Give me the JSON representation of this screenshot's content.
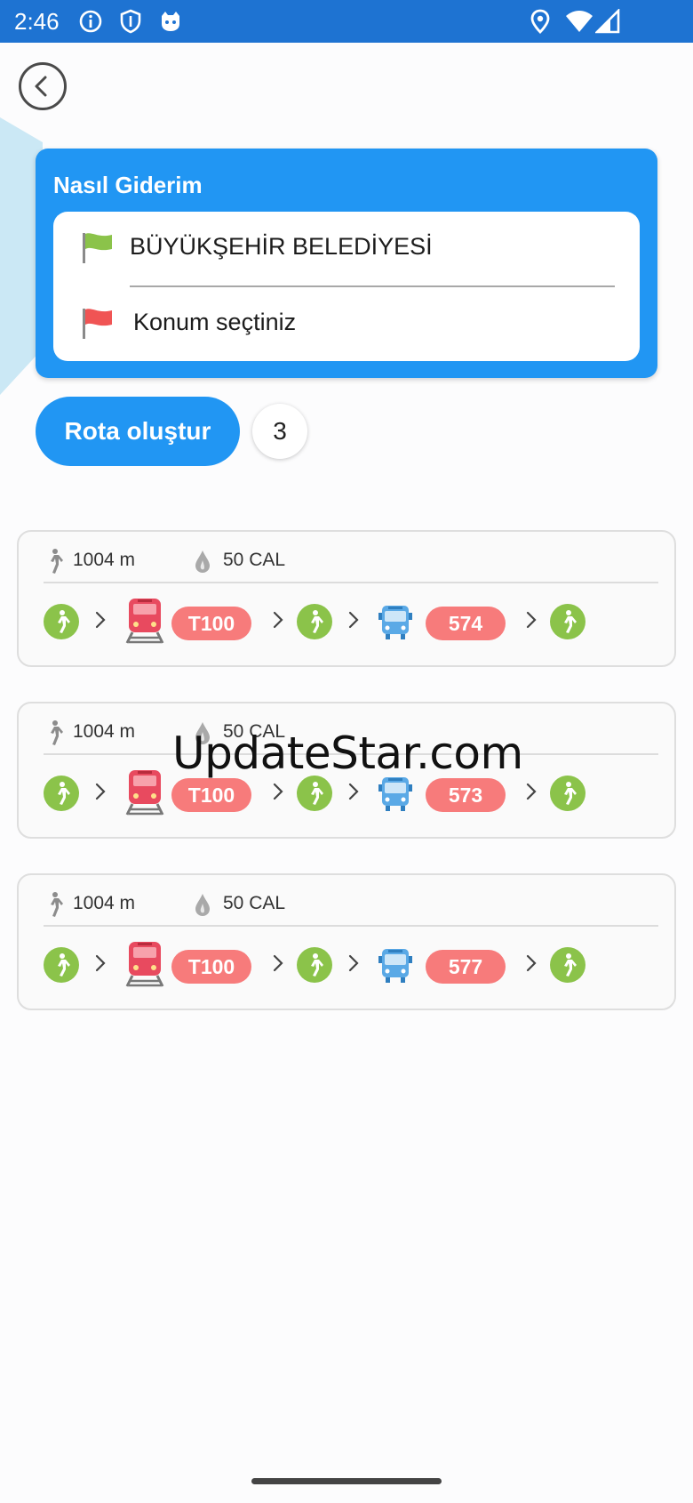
{
  "status_bar": {
    "time": "2:46",
    "left_icons": [
      "info-icon",
      "shield-icon",
      "cat-icon"
    ],
    "right_icons": [
      "location-icon",
      "wifi-icon",
      "signal-icon"
    ]
  },
  "header": {
    "back_icon": "chevron-left-icon"
  },
  "planner": {
    "title": "Nasıl Giderim",
    "from_label": "BÜYÜKŞEHİR BELEDİYESİ",
    "from_flag_color": "#8bc34a",
    "to_label": "Konum seçtiniz",
    "to_flag_color": "#f05454"
  },
  "route_button": {
    "label": "Rota oluştur"
  },
  "route_count": "3",
  "routes": [
    {
      "distance": "1004 m",
      "calories": "50 CAL",
      "steps": [
        {
          "type": "walk"
        },
        {
          "type": "train",
          "line": "T100"
        },
        {
          "type": "walk"
        },
        {
          "type": "bus",
          "line": "574"
        },
        {
          "type": "walk"
        }
      ]
    },
    {
      "distance": "1004 m",
      "calories": "50 CAL",
      "steps": [
        {
          "type": "walk"
        },
        {
          "type": "train",
          "line": "T100"
        },
        {
          "type": "walk"
        },
        {
          "type": "bus",
          "line": "573"
        },
        {
          "type": "walk"
        }
      ]
    },
    {
      "distance": "1004 m",
      "calories": "50 CAL",
      "steps": [
        {
          "type": "walk"
        },
        {
          "type": "train",
          "line": "T100"
        },
        {
          "type": "walk"
        },
        {
          "type": "bus",
          "line": "577"
        },
        {
          "type": "walk"
        }
      ]
    }
  ],
  "watermark": "UpdateStar.com",
  "colors": {
    "primary": "#2196f3",
    "status_bar": "#1e73d2",
    "walk_green": "#8bc34a",
    "line_pill": "#f77b7b"
  }
}
